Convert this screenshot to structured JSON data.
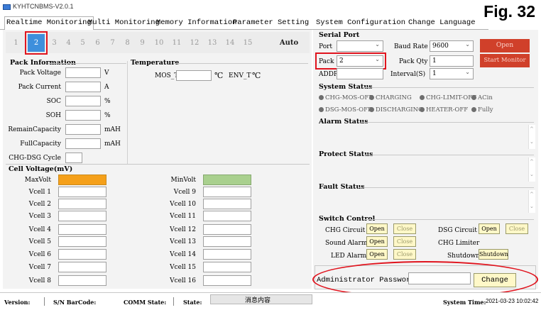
{
  "window": {
    "title": "KYHTCNBMS-V2.0.1"
  },
  "figure_label": "Fig. 32",
  "tabs": [
    "Realtime Monitoring",
    "Multi Monitoring",
    "Memory Information",
    "Parameter Setting",
    "System Configuration",
    "Change Language"
  ],
  "pack_buttons": [
    "1",
    "2",
    "3",
    "4",
    "5",
    "6",
    "7",
    "8",
    "9",
    "10",
    "11",
    "12",
    "13",
    "14",
    "15",
    "Auto"
  ],
  "selected_pack": "2",
  "pack_info": {
    "title": "Pack Information",
    "rows": [
      {
        "label": "Pack Voltage",
        "unit": "V"
      },
      {
        "label": "Pack Current",
        "unit": "A"
      },
      {
        "label": "SOC",
        "unit": "%"
      },
      {
        "label": "SOH",
        "unit": "%"
      },
      {
        "label": "RemainCapacity",
        "unit": "mAH"
      },
      {
        "label": "FullCapacity",
        "unit": "mAH"
      },
      {
        "label": "CHG-DSG Cycle",
        "unit": ""
      }
    ]
  },
  "temperature": {
    "title": "Temperature",
    "mos_label": "MOS_T",
    "env_label": "ENV_T",
    "unit": "℃"
  },
  "cell_voltage": {
    "title": "Cell Voltage(mV)",
    "max_label": "MaxVolt",
    "min_label": "MinVolt",
    "left": [
      "Vcell 1",
      "Vcell 2",
      "Vcell 3",
      "Vcell 4",
      "Vcell 5",
      "Vcell 6",
      "Vcell 7",
      "Vcell 8"
    ],
    "right": [
      "Vcell 9",
      "Vcell 10",
      "Vcell 11",
      "Vcell 12",
      "Vcell 13",
      "Vcell 14",
      "Vcell 15",
      "Vcell 16"
    ],
    "max_color": "#f5a01a",
    "min_color": "#a9d08e"
  },
  "serial_port": {
    "title": "Serial Port",
    "port_label": "Port",
    "port_value": "",
    "baud_label": "Baud Rate",
    "baud_value": "9600",
    "open_label": "Open",
    "pack_label": "Pack",
    "pack_value": "2",
    "pack_qty_label": "Pack Qty",
    "pack_qty_value": "1",
    "start_label": "Start Monitor",
    "addr_label": "ADDR",
    "addr_value": "",
    "interval_label": "Interval(S)",
    "interval_value": "1",
    "button_color": "#d0402a"
  },
  "system_status": {
    "title": "System Status",
    "items": [
      "CHG-MOS-OFF",
      "CHARGING",
      "CHG-LIMIT-OFF",
      "ACin",
      "DSG-MOS-OFF",
      "DISCHARGING",
      "HEATER-OFF",
      "Fully"
    ]
  },
  "alarm_status": {
    "title": "Alarm Status"
  },
  "protect_status": {
    "title": "Protect Status"
  },
  "fault_status": {
    "title": "Fault Status"
  },
  "switch_control": {
    "title": "Switch Control",
    "chg_label": "CHG Circuit",
    "dsg_label": "DSG Circuit",
    "sound_label": "Sound Alarm",
    "chg_limiter_label": "CHG Limiter",
    "led_label": "LED Alarm",
    "shutdown_label": "Shutdown",
    "open_label": "Open",
    "close_label": "Close",
    "shutdown_btn": "Shutdown"
  },
  "admin": {
    "label": "Administrator Password",
    "password_value": "",
    "change_label": "Change"
  },
  "status_bar": {
    "version_label": "Version:",
    "barcode_label": "S/N BarCode:",
    "comm_label": "COMM State:",
    "state_label": "State:",
    "message": "消息内容",
    "time_label": "System Time:",
    "time_value": "2021-03-23 10:02:42"
  },
  "highlight_color": "#e0141e"
}
